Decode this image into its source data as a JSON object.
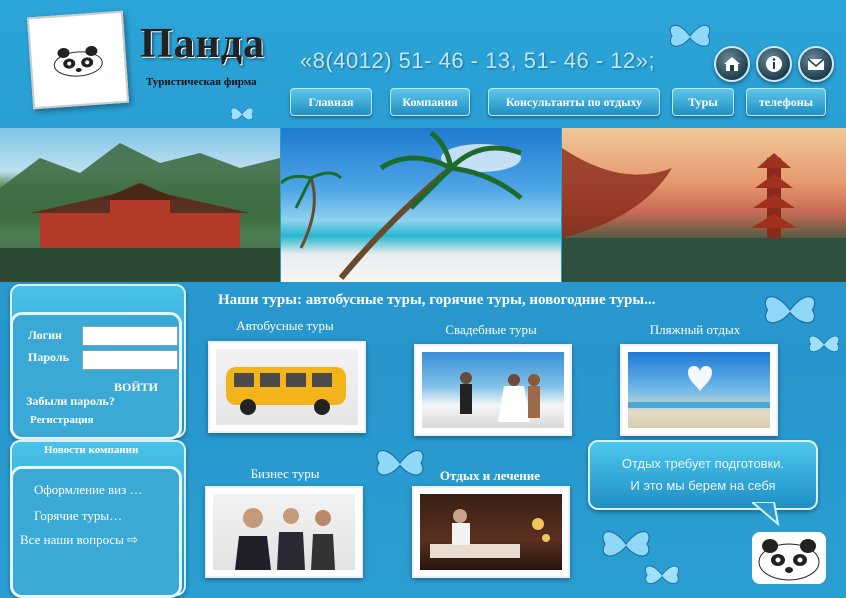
{
  "brand": {
    "name": "Панда",
    "subtitle": "Туристическая фирма"
  },
  "phone": "«8(4012) 51- 46 - 13, 51- 46 - 12»;",
  "icons": [
    "home-icon",
    "info-icon",
    "mail-icon"
  ],
  "nav": [
    {
      "label": "Главная"
    },
    {
      "label": "Компания"
    },
    {
      "label": "Консультанты по отдыху"
    },
    {
      "label": "Туры"
    },
    {
      "label": "телефоны"
    }
  ],
  "login": {
    "login_label": "Логин",
    "password_label": "Пароль",
    "submit_label": "ВОЙТИ",
    "forgot_label": "Забыли пароль?",
    "register_label": "Регистрация"
  },
  "news": {
    "title": "Новости компании",
    "items": [
      "Оформление виз …",
      "Горячие туры…",
      "Все наши вопросы ⇨"
    ]
  },
  "main": {
    "heading": "Наши туры: автобусные туры, горячие туры, новогодние туры...",
    "tours": [
      {
        "label": "Автобусные туры"
      },
      {
        "label": "Свадебные туры"
      },
      {
        "label": "Пляжный отдых"
      },
      {
        "label": "Бизнес  туры"
      },
      {
        "label": "Отдых и лечение"
      }
    ]
  },
  "bubble": {
    "line1": "Отдых требует подготовки.",
    "line2": "И это мы берем на себя"
  },
  "colors": {
    "background": "#2ba4d8",
    "accent": "#1f8fc2",
    "text_light": "#ffffff"
  }
}
